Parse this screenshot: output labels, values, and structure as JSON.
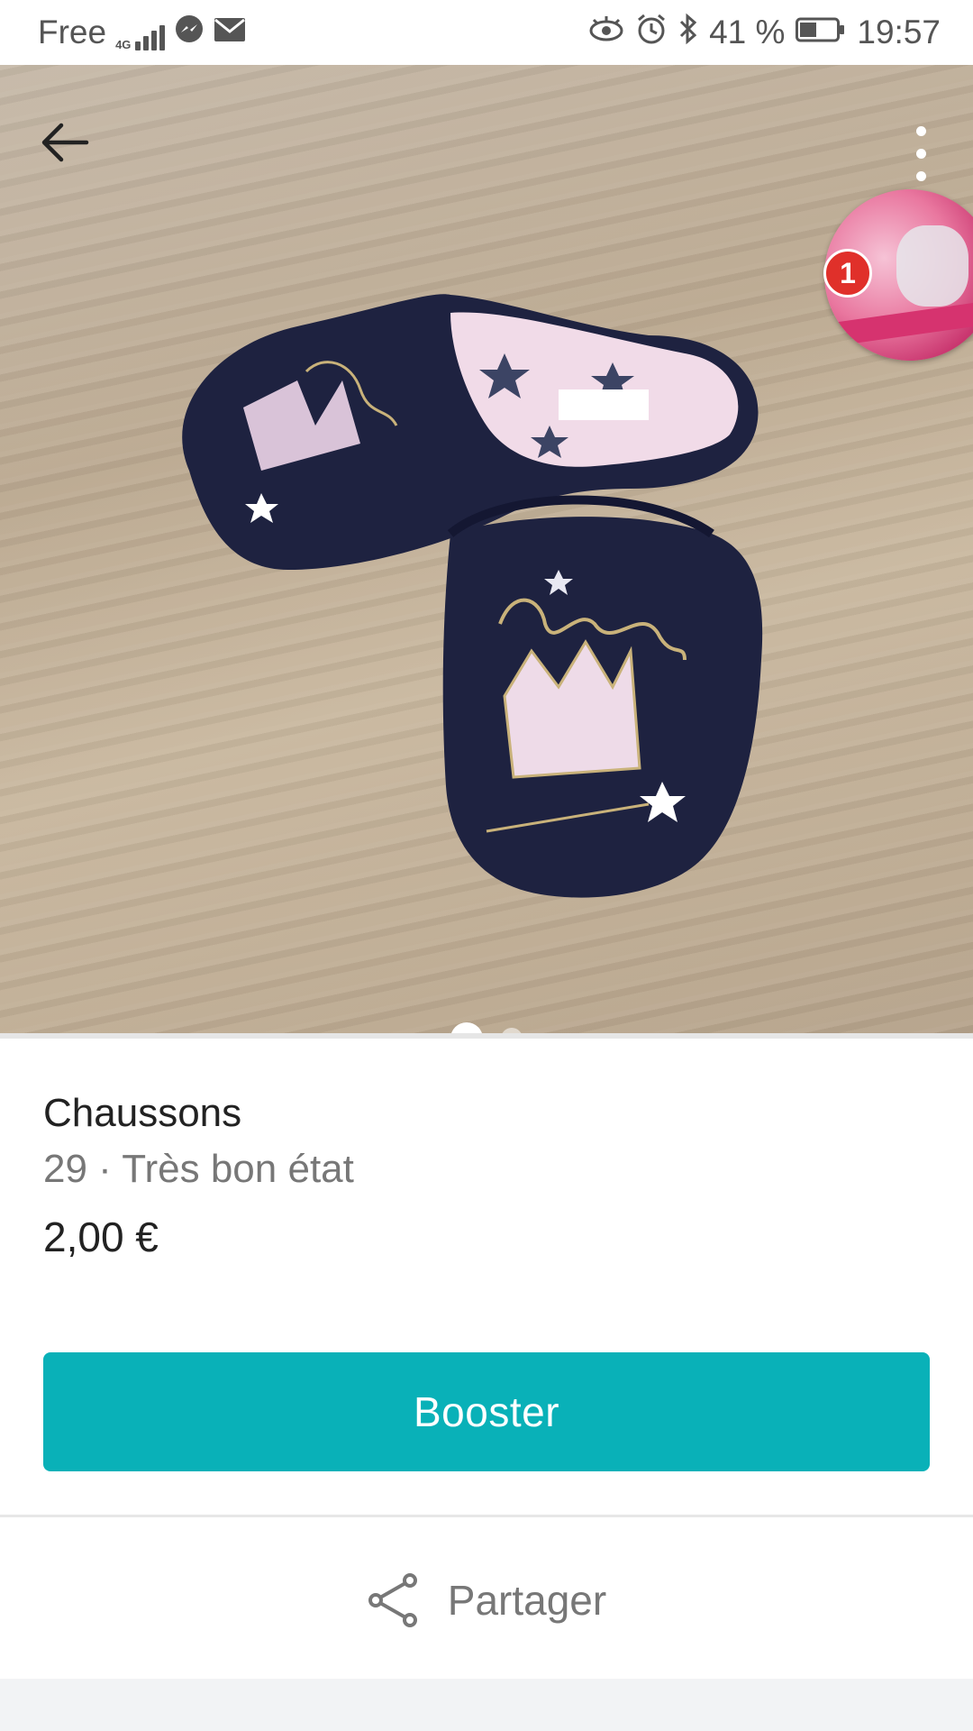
{
  "status_bar": {
    "carrier": "Free",
    "network": "4G",
    "battery": "41 %",
    "time": "19:57",
    "icons": [
      "signal-icon",
      "messenger-icon",
      "mail-icon",
      "eye-icon",
      "alarm-icon",
      "bluetooth-icon",
      "battery-icon"
    ]
  },
  "gallery": {
    "image_subject": "navy slippers with 'lucky' crown print",
    "page_count": 2,
    "active_page": 1,
    "notification_count": "1"
  },
  "item": {
    "title": "Chaussons",
    "meta": "29 · Très bon état",
    "price": "2,00 €"
  },
  "actions": {
    "booster_label": "Booster",
    "share_label": "Partager"
  },
  "colors": {
    "accent": "#09b1b8",
    "badge": "#e0302a"
  }
}
